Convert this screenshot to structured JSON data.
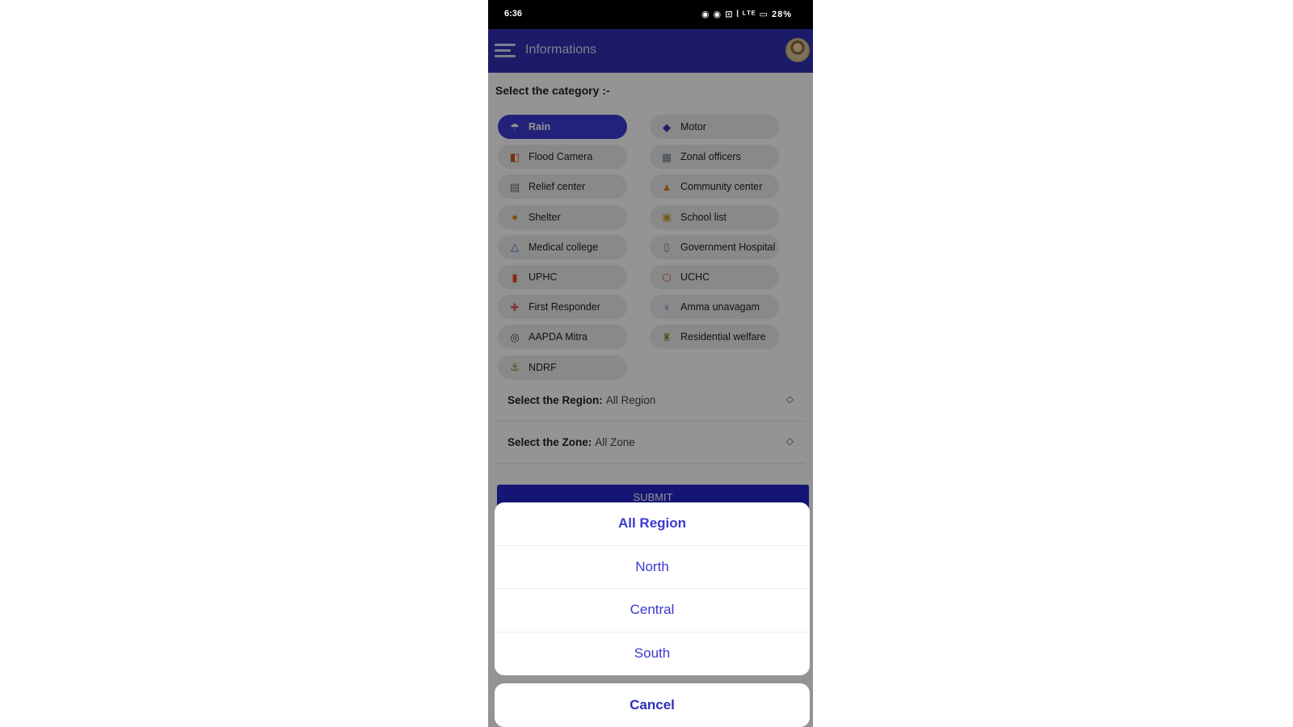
{
  "status_bar": {
    "time": "6:36",
    "icons_text": "◉ ◉ ⊡ ⦚ ᴸᵀᴱ ▭ 28%"
  },
  "app_bar": {
    "title": "Informations"
  },
  "category_section": {
    "label": "Select the category :-",
    "items": [
      {
        "label": "Rain",
        "icon": "umbrella-icon",
        "glyph": "☂",
        "color": "#ffffff",
        "selected": true
      },
      {
        "label": "Motor",
        "icon": "motor-icon",
        "glyph": "◆",
        "color": "#4b2aa8",
        "selected": false
      },
      {
        "label": "Flood Camera",
        "icon": "flood-camera-icon",
        "glyph": "◧",
        "color": "#d24b2a",
        "selected": false
      },
      {
        "label": "Zonal officers",
        "icon": "zonal-officers-icon",
        "glyph": "▦",
        "color": "#6a7f8a",
        "selected": false
      },
      {
        "label": "Relief center",
        "icon": "relief-center-icon",
        "glyph": "▤",
        "color": "#5f6f7a",
        "selected": false
      },
      {
        "label": "Community center",
        "icon": "community-center-icon",
        "glyph": "▲",
        "color": "#d9861f",
        "selected": false
      },
      {
        "label": "Shelter",
        "icon": "shelter-icon",
        "glyph": "●",
        "color": "#e0872a",
        "selected": false
      },
      {
        "label": "School list",
        "icon": "school-icon",
        "glyph": "▣",
        "color": "#c7a23a",
        "selected": false
      },
      {
        "label": "Medical college",
        "icon": "medical-college-icon",
        "glyph": "△",
        "color": "#3b7bd4",
        "selected": false
      },
      {
        "label": "Government Hospital",
        "icon": "hospital-icon",
        "glyph": "▯",
        "color": "#777777",
        "selected": false
      },
      {
        "label": "UPHC",
        "icon": "uphc-icon",
        "glyph": "▮",
        "color": "#e0452a",
        "selected": false
      },
      {
        "label": "UCHC",
        "icon": "uchc-icon",
        "glyph": "⬡",
        "color": "#d9534f",
        "selected": false
      },
      {
        "label": "First Responder",
        "icon": "first-responder-icon",
        "glyph": "✚",
        "color": "#e05a6a",
        "selected": false
      },
      {
        "label": "Amma unavagam",
        "icon": "amma-unavagam-icon",
        "glyph": "♀",
        "color": "#7a2ab8",
        "selected": false
      },
      {
        "label": "AAPDA Mitra",
        "icon": "aapda-mitra-icon",
        "glyph": "◎",
        "color": "#3a4a3a",
        "selected": false
      },
      {
        "label": "Residential welfare",
        "icon": "residential-welfare-icon",
        "glyph": "♜",
        "color": "#8a9a3a",
        "selected": false
      },
      {
        "label": "NDRF",
        "icon": "ndrf-icon",
        "glyph": "⚓",
        "color": "#7a8a3a",
        "selected": false
      }
    ]
  },
  "region_select": {
    "label": "Select the Region:",
    "value": "All Region",
    "arrow": "◇"
  },
  "zone_select": {
    "label": "Select the Zone:",
    "value": "All Zone",
    "arrow": "◇"
  },
  "submit": {
    "label": "SUBMIT"
  },
  "action_sheet": {
    "options": [
      {
        "label": "All Region",
        "selected": true
      },
      {
        "label": "North",
        "selected": false
      },
      {
        "label": "Central",
        "selected": false
      },
      {
        "label": "South",
        "selected": false
      }
    ],
    "cancel_label": "Cancel"
  },
  "colors": {
    "app_bar": "#2f2fb3",
    "accent": "#3a3ad0",
    "chip_selected": "#3b3bd4",
    "chip_default": "#ececec"
  }
}
